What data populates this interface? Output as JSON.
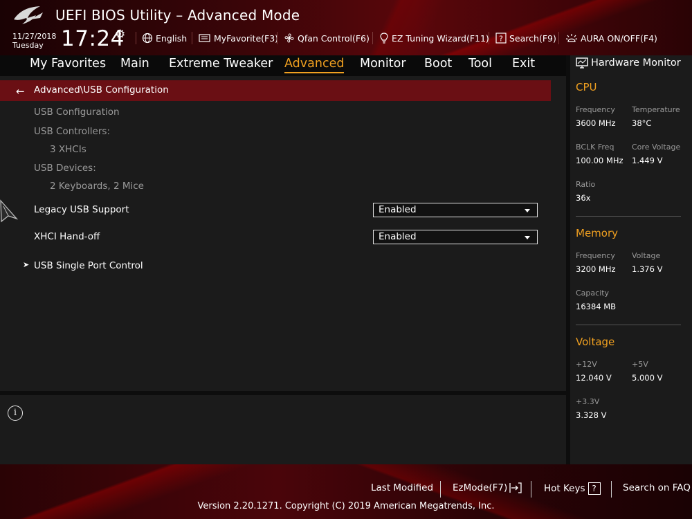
{
  "header": {
    "title": "UEFI BIOS Utility – Advanced Mode",
    "date": "11/27/2018",
    "day": "Tuesday",
    "time": "17:24",
    "buttons": [
      {
        "label": "English",
        "icon": "globe-icon"
      },
      {
        "label": "MyFavorite(F3)",
        "icon": "favorite-icon"
      },
      {
        "label": "Qfan Control(F6)",
        "icon": "fan-icon"
      },
      {
        "label": "EZ Tuning Wizard(F11)",
        "icon": "bulb-icon"
      },
      {
        "label": "Search(F9)",
        "icon": "search-icon"
      },
      {
        "label": "AURA ON/OFF(F4)",
        "icon": "aura-icon"
      }
    ]
  },
  "nav": {
    "tabs": [
      {
        "label": "My Favorites"
      },
      {
        "label": "Main"
      },
      {
        "label": "Extreme Tweaker"
      },
      {
        "label": "Advanced",
        "active": true
      },
      {
        "label": "Monitor"
      },
      {
        "label": "Boot"
      },
      {
        "label": "Tool"
      },
      {
        "label": "Exit"
      }
    ]
  },
  "main": {
    "breadcrumb": "Advanced\\USB Configuration",
    "section_title": "USB Configuration",
    "controllers_label": "USB Controllers:",
    "controllers_value": "3 XHCIs",
    "devices_label": "USB Devices:",
    "devices_value": "2 Keyboards, 2 Mice",
    "settings": [
      {
        "label": "Legacy USB Support",
        "value": "Enabled"
      },
      {
        "label": "XHCI Hand-off",
        "value": "Enabled"
      }
    ],
    "submenu": "USB Single Port Control"
  },
  "hardware_monitor": {
    "title": "Hardware Monitor",
    "cpu": {
      "title": "CPU",
      "frequency_label": "Frequency",
      "frequency": "3600 MHz",
      "temperature_label": "Temperature",
      "temperature": "38°C",
      "bclk_label": "BCLK Freq",
      "bclk": "100.00 MHz",
      "core_voltage_label": "Core Voltage",
      "core_voltage": "1.449 V",
      "ratio_label": "Ratio",
      "ratio": "36x"
    },
    "memory": {
      "title": "Memory",
      "frequency_label": "Frequency",
      "frequency": "3200 MHz",
      "voltage_label": "Voltage",
      "voltage": "1.376 V",
      "capacity_label": "Capacity",
      "capacity": "16384 MB"
    },
    "voltage": {
      "title": "Voltage",
      "v12_label": "+12V",
      "v12": "12.040 V",
      "v5_label": "+5V",
      "v5": "5.000 V",
      "v33_label": "+3.3V",
      "v33": "3.328 V"
    }
  },
  "footer": {
    "last_modified": "Last Modified",
    "ezmode": "EzMode(F7)",
    "hotkeys": "Hot Keys",
    "hotkeys_box": "?",
    "faq": "Search on FAQ",
    "version": "Version 2.20.1271. Copyright (C) 2019 American Megatrends, Inc."
  },
  "colors": {
    "accent": "#f0a020",
    "breadcrumb_bg": "#6a0f14",
    "panel_bg": "#1b1b1b"
  }
}
